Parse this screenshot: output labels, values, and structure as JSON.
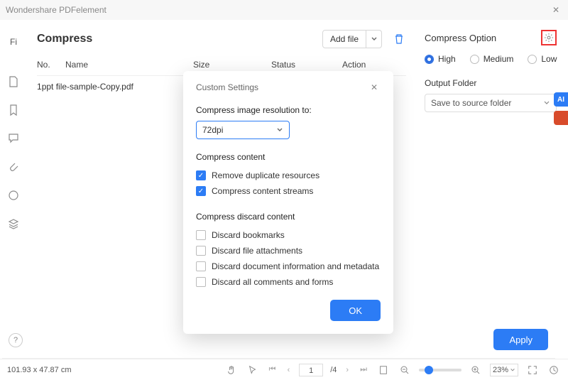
{
  "titlebar": {
    "app_name": "Wondershare PDFelement"
  },
  "leftrail_icons": [
    "file",
    "bookmark",
    "comment",
    "attach",
    "circle",
    "stack"
  ],
  "header": {
    "title": "Compress",
    "add_file_label": "Add file"
  },
  "columns": {
    "no": "No.",
    "name": "Name",
    "size": "Size",
    "status": "Status",
    "action": "Action"
  },
  "rows": [
    {
      "no": "1",
      "name": "ppt file-sample-Copy.pdf"
    }
  ],
  "right": {
    "option_title": "Compress Option",
    "radios": {
      "high": "High",
      "medium": "Medium",
      "low": "Low"
    },
    "selected_radio": "high",
    "output_folder_label": "Output Folder",
    "output_folder_value": "Save to source folder"
  },
  "modal": {
    "title": "Custom Settings",
    "resolution_label": "Compress image resolution to:",
    "resolution_value": "72dpi",
    "content_title": "Compress content",
    "content_checks": [
      {
        "label": "Remove duplicate resources",
        "checked": true
      },
      {
        "label": "Compress content streams",
        "checked": true
      }
    ],
    "discard_title": "Compress discard content",
    "discard_checks": [
      {
        "label": "Discard bookmarks",
        "checked": false
      },
      {
        "label": "Discard file attachments",
        "checked": false
      },
      {
        "label": "Discard document information and metadata",
        "checked": false
      },
      {
        "label": "Discard all comments and forms",
        "checked": false
      }
    ],
    "ok": "OK"
  },
  "apply_label": "Apply",
  "status": {
    "dims": "101.93 x 47.87 cm",
    "page_current": "1",
    "page_total": "/4",
    "zoom": "23%"
  },
  "sidetags": [
    {
      "text": "AI",
      "bg": "#2c7cf5"
    },
    {
      "text": "",
      "bg": "#d84b2b"
    }
  ]
}
